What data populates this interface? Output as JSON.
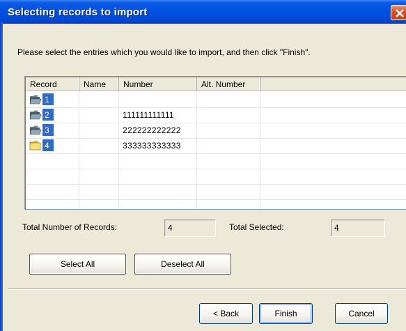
{
  "window": {
    "title": "Selecting records to import"
  },
  "instruction": "Please select the entries which you would like to import, and then click \"Finish\".",
  "list": {
    "columns": [
      "Record",
      "Name",
      "Number",
      "Alt. Number"
    ],
    "rows": [
      {
        "record": "1",
        "name": "",
        "number": "",
        "alt_number": "",
        "icon": "folder-open-gray-icon"
      },
      {
        "record": "2",
        "name": "",
        "number": "111111111111",
        "alt_number": "",
        "icon": "folder-open-gray-icon"
      },
      {
        "record": "3",
        "name": "",
        "number": "222222222222",
        "alt_number": "",
        "icon": "folder-open-gray-icon"
      },
      {
        "record": "4",
        "name": "",
        "number": "333333333333",
        "alt_number": "",
        "icon": "folder-yellow-icon"
      }
    ]
  },
  "summary": {
    "total_records_label": "Total Number of Records:",
    "total_records_value": "4",
    "total_selected_label": "Total Selected:",
    "total_selected_value": "4"
  },
  "buttons": {
    "select_all": "Select All",
    "deselect_all": "Deselect All",
    "back": "< Back",
    "finish": "Finish",
    "cancel": "Cancel"
  },
  "colors": {
    "titlebar": "#0050e0",
    "selection": "#316ac5",
    "dialog_bg": "#ece9d8",
    "close_button": "#d8542c"
  }
}
